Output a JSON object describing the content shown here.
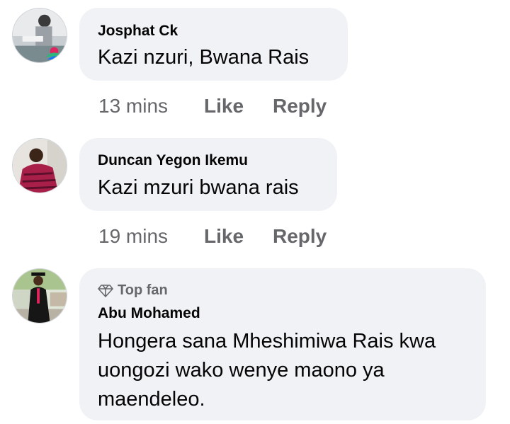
{
  "comments": [
    {
      "author": "Josphat Ck",
      "text": "Kazi nzuri,  Bwana Rais",
      "time": "13 mins",
      "like_label": "Like",
      "reply_label": "Reply"
    },
    {
      "author": "Duncan Yegon Ikemu",
      "text": "Kazi mzuri bwana rais",
      "time": "19 mins",
      "like_label": "Like",
      "reply_label": "Reply"
    },
    {
      "badge": "Top fan",
      "badge_icon": "diamond-icon",
      "author": "Abu Mohamed",
      "text_lines": [
        "Hongera sana Mheshimiwa Rais kwa",
        "uongozi wako wenye maono ya",
        "maendeleo."
      ]
    }
  ],
  "colors": {
    "bubble": "#f0f2f5",
    "secondary_text": "#65676b",
    "primary_text": "#050505"
  }
}
